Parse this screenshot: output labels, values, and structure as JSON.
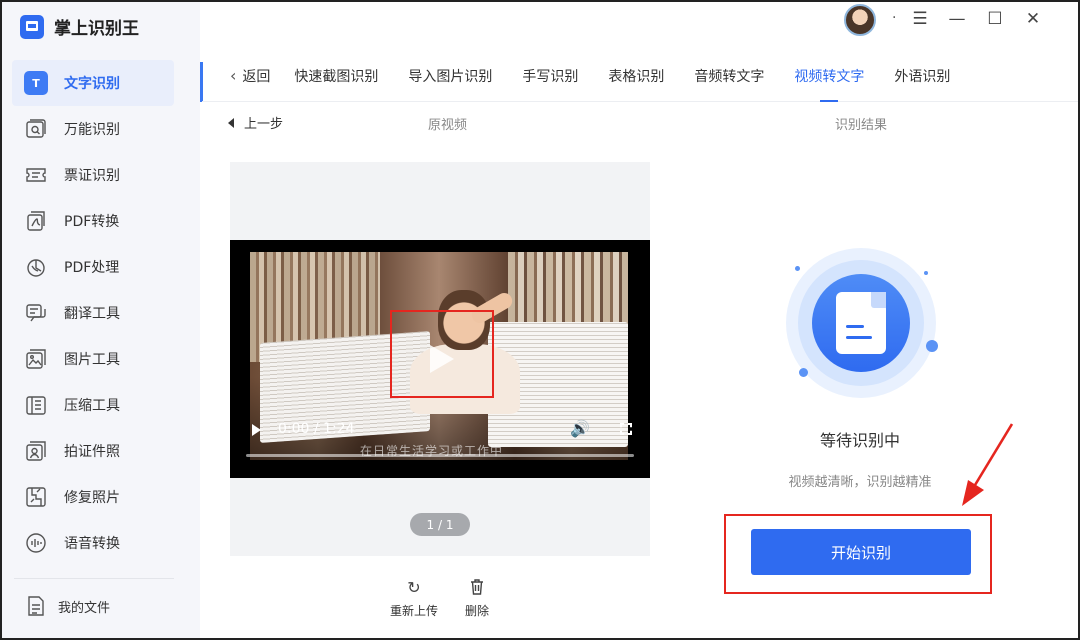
{
  "app": {
    "name": "掌上识别王"
  },
  "titlebar": {
    "dot": "·",
    "menu_icon": "menu-icon",
    "min_icon": "minimize-icon",
    "max_icon": "maximize-icon",
    "close_icon": "close-icon"
  },
  "sidebar": {
    "items": [
      {
        "label": "文字识别",
        "icon": "text-recognition-icon",
        "active": true,
        "icon_text": "T"
      },
      {
        "label": "万能识别",
        "icon": "universal-scan-icon"
      },
      {
        "label": "票证识别",
        "icon": "ticket-icon"
      },
      {
        "label": "PDF转换",
        "icon": "pdf-convert-icon"
      },
      {
        "label": "PDF处理",
        "icon": "pdf-process-icon"
      },
      {
        "label": "翻译工具",
        "icon": "translate-icon"
      },
      {
        "label": "图片工具",
        "icon": "image-tool-icon"
      },
      {
        "label": "压缩工具",
        "icon": "compress-icon"
      },
      {
        "label": "拍证件照",
        "icon": "id-photo-icon"
      },
      {
        "label": "修复照片",
        "icon": "repair-photo-icon"
      },
      {
        "label": "语音转换",
        "icon": "voice-convert-icon"
      }
    ],
    "my_files": "我的文件"
  },
  "tabs": {
    "back": "返回",
    "items": [
      {
        "label": "快速截图识别"
      },
      {
        "label": "导入图片识别"
      },
      {
        "label": "手写识别"
      },
      {
        "label": "表格识别"
      },
      {
        "label": "音频转文字"
      },
      {
        "label": "视频转文字",
        "active": true
      },
      {
        "label": "外语识别"
      }
    ]
  },
  "subheader": {
    "prev": "上一步",
    "original": "原视频",
    "result": "识别结果"
  },
  "video": {
    "time": "0:00 / 1:24",
    "subtitle": "在日常生活学习或工作中",
    "page": "1 / 1"
  },
  "actions": {
    "reupload": "重新上传",
    "delete": "删除"
  },
  "result": {
    "status": "等待识别中",
    "hint": "视频越清晰，识别越精准",
    "start_button": "开始识别"
  },
  "colors": {
    "accent": "#2f6bf0",
    "highlight": "#e5261f"
  }
}
